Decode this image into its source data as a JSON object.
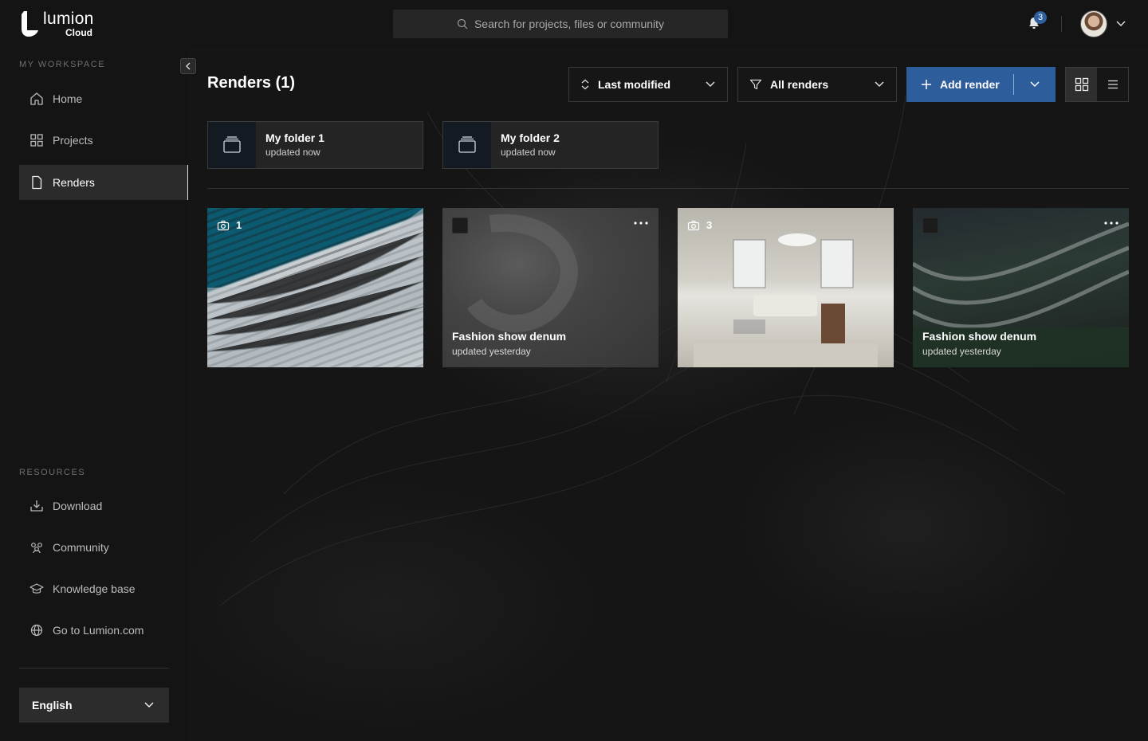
{
  "brand": {
    "name": "lumion",
    "sub": "Cloud"
  },
  "search": {
    "placeholder": "Search for projects, files or community"
  },
  "notifications": {
    "count": "3"
  },
  "sidebar": {
    "workspace_label": "MY WORKSPACE",
    "items": [
      {
        "label": "Home",
        "icon": "home-icon"
      },
      {
        "label": "Projects",
        "icon": "grid-icon"
      },
      {
        "label": "Renders",
        "icon": "file-icon",
        "active": true
      }
    ],
    "resources_label": "RESOURCES",
    "resources": [
      {
        "label": "Download",
        "icon": "download-icon"
      },
      {
        "label": "Community",
        "icon": "community-icon"
      },
      {
        "label": "Knowledge base",
        "icon": "graduation-cap-icon"
      },
      {
        "label": "Go to Lumion.com",
        "icon": "globe-icon"
      }
    ],
    "language": "English"
  },
  "main": {
    "title": "Renders (1)",
    "sort_label": "Last modified",
    "filter_label": "All renders",
    "add_label": "Add render",
    "view_mode": "grid",
    "folders": [
      {
        "name": "My folder 1",
        "meta": "updated now"
      },
      {
        "name": "My folder 2",
        "meta": "updated now"
      }
    ],
    "cards": [
      {
        "type": "image-set",
        "count": "1"
      },
      {
        "type": "render",
        "title": "Fashion show denum",
        "meta": "updated yesterday"
      },
      {
        "type": "image-set",
        "count": "3"
      },
      {
        "type": "render",
        "title": "Fashion show denum",
        "meta": "updated yesterday"
      }
    ]
  },
  "colors": {
    "accent": "#2e5d9c",
    "background": "#141414",
    "panel": "#242424"
  }
}
